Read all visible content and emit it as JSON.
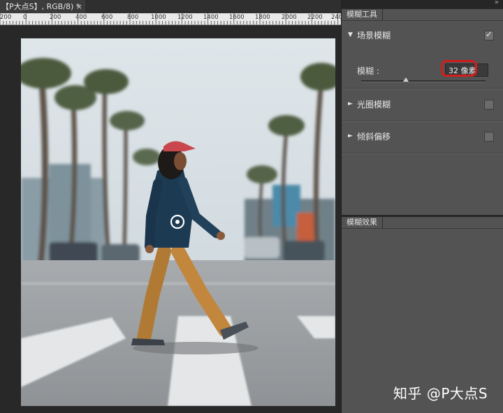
{
  "document": {
    "tab_title": "【P大点S】, RGB/8) *",
    "close_glyph": "×"
  },
  "ruler": {
    "labels": [
      "200",
      "0",
      "200",
      "400",
      "600",
      "800",
      "1000",
      "1200",
      "1400",
      "1600",
      "1800",
      "2000",
      "2200",
      "240"
    ]
  },
  "blur_panel": {
    "tab": "模糊工具",
    "sections": [
      {
        "label": "场景模糊",
        "expanded": true,
        "checked": true
      },
      {
        "label": "光圈模糊",
        "expanded": false,
        "checked": false
      },
      {
        "label": "倾斜偏移",
        "expanded": false,
        "checked": false
      }
    ],
    "blur_label": "模糊 :",
    "blur_value": "32 像素",
    "slider_fraction": 0.36
  },
  "effects_panel": {
    "tab": "模糊效果"
  },
  "watermark": "知乎 @P大点S",
  "colors": {
    "highlight": "#d11d1d",
    "panel_bg": "#535353",
    "workspace_bg": "#282828"
  }
}
